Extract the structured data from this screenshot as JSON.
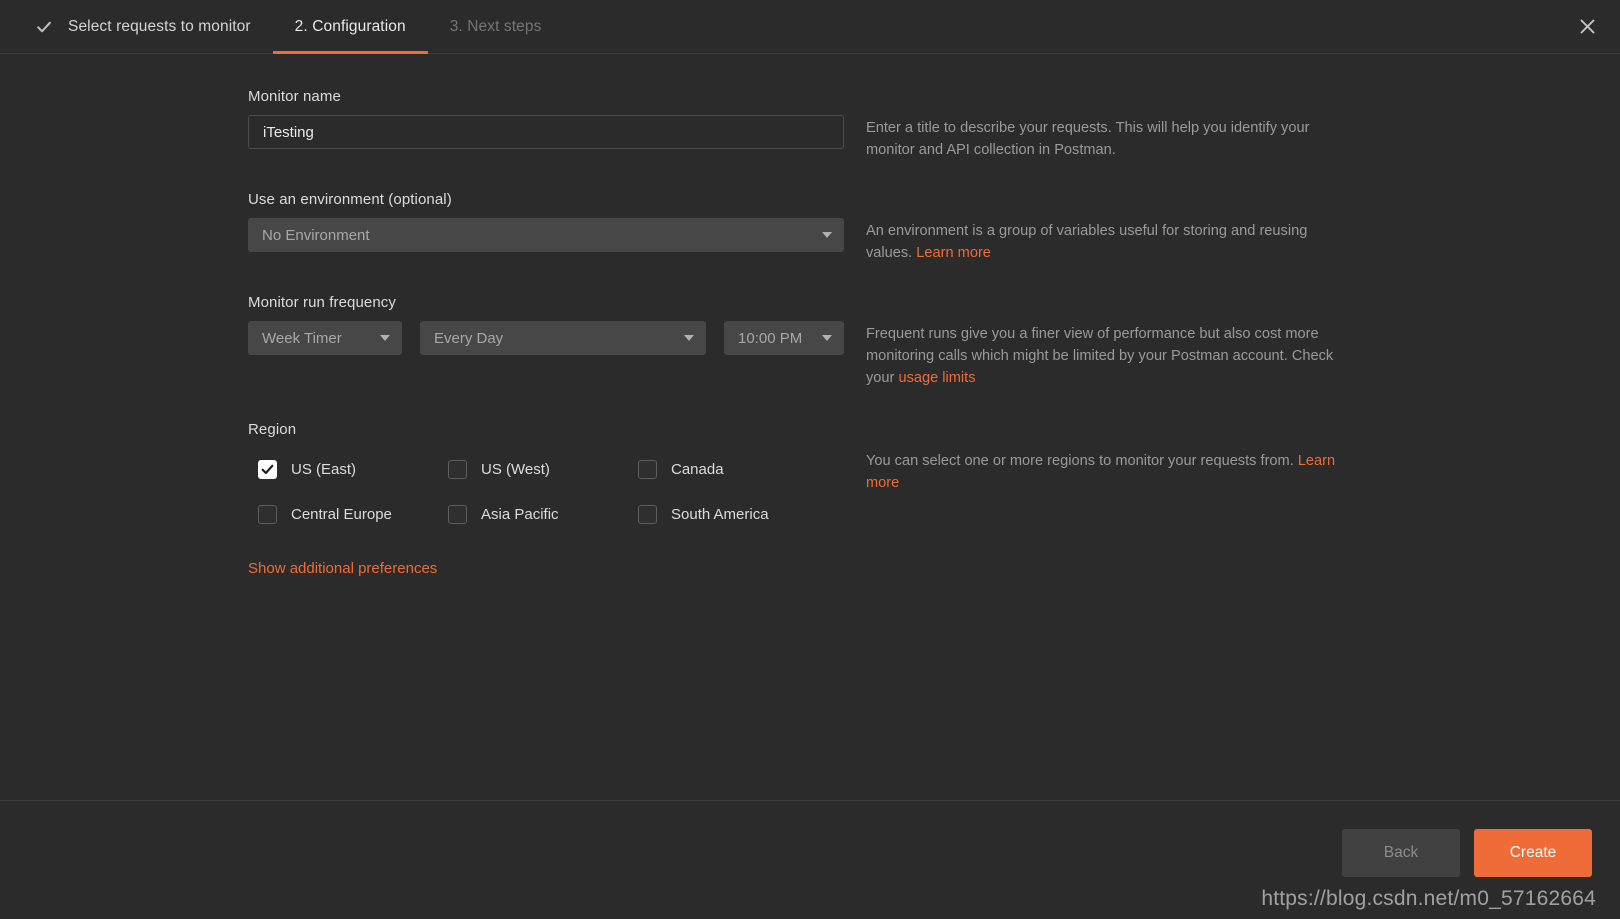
{
  "window": {
    "close_icon": "close-icon"
  },
  "steps": [
    {
      "label": "Select requests to monitor",
      "state": "done",
      "icon": "check-icon"
    },
    {
      "label": "2. Configuration",
      "state": "active"
    },
    {
      "label": "3. Next steps",
      "state": "upcoming"
    }
  ],
  "form": {
    "monitor_name": {
      "label": "Monitor name",
      "value": "iTesting",
      "placeholder": "",
      "help": "Enter a title to describe your requests. This will help you identify your monitor and API collection in Postman."
    },
    "environment": {
      "label": "Use an environment (optional)",
      "value": "No Environment",
      "help_prefix": "An environment is a group of variables useful for storing and reusing values. ",
      "help_link": "Learn more"
    },
    "frequency": {
      "label": "Monitor run frequency",
      "type_value": "Week Timer",
      "interval_value": "Every Day",
      "time_value": "10:00 PM",
      "help_prefix": "Frequent runs give you a finer view of performance but also cost more monitoring calls which might be limited by your Postman account. Check your ",
      "help_link": "usage limits"
    },
    "region": {
      "label": "Region",
      "items": [
        {
          "label": "US (East)",
          "checked": true
        },
        {
          "label": "US (West)",
          "checked": false
        },
        {
          "label": "Canada",
          "checked": false
        },
        {
          "label": "Central Europe",
          "checked": false
        },
        {
          "label": "Asia Pacific",
          "checked": false
        },
        {
          "label": "South America",
          "checked": false
        }
      ],
      "help_prefix": "You can select one or more regions to monitor your requests from. ",
      "help_link": "Learn more"
    },
    "show_additional_preferences": "Show additional preferences"
  },
  "footer": {
    "back_label": "Back",
    "create_label": "Create"
  },
  "watermark": "https://blog.csdn.net/m0_57162664",
  "colors": {
    "accent": "#ef6b38",
    "background": "#2b2b2b",
    "select_bg": "#474747",
    "text": "#e6e6e6",
    "muted": "#9a9a9a"
  }
}
